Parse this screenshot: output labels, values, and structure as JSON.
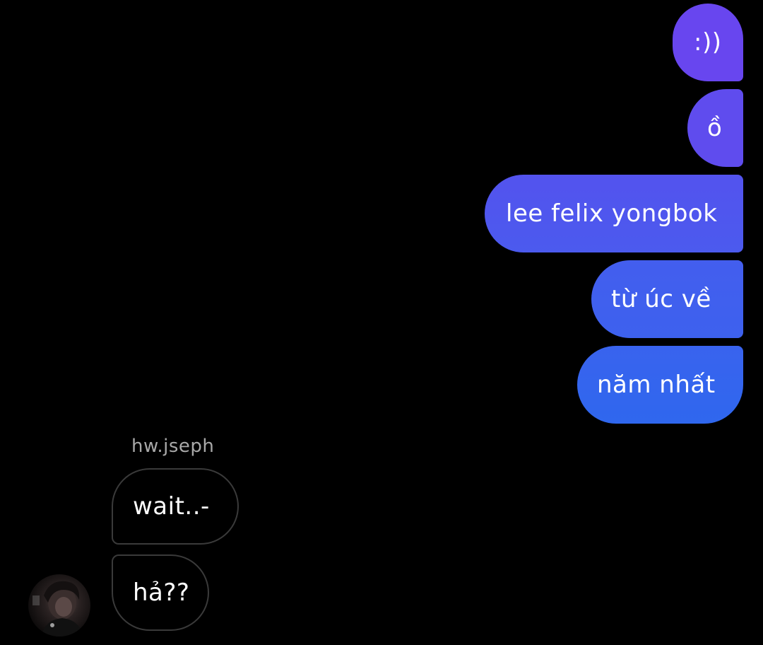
{
  "outgoing": [
    {
      "text": ":))"
    },
    {
      "text": "ồ"
    },
    {
      "text": "lee felix yongbok"
    },
    {
      "text": "từ úc về"
    },
    {
      "text": "năm nhất"
    }
  ],
  "incoming": {
    "sender": "hw.jseph",
    "messages": [
      {
        "text": "wait..-"
      },
      {
        "text": "hả??"
      }
    ]
  },
  "colors": {
    "background": "#000000",
    "outgoing_top": "#6a45f0",
    "outgoing_bottom": "#2f64ef",
    "incoming_border": "#3a3a3a",
    "sender_name": "#a8a8a8"
  },
  "icons": {
    "avatar": "profile-photo"
  }
}
